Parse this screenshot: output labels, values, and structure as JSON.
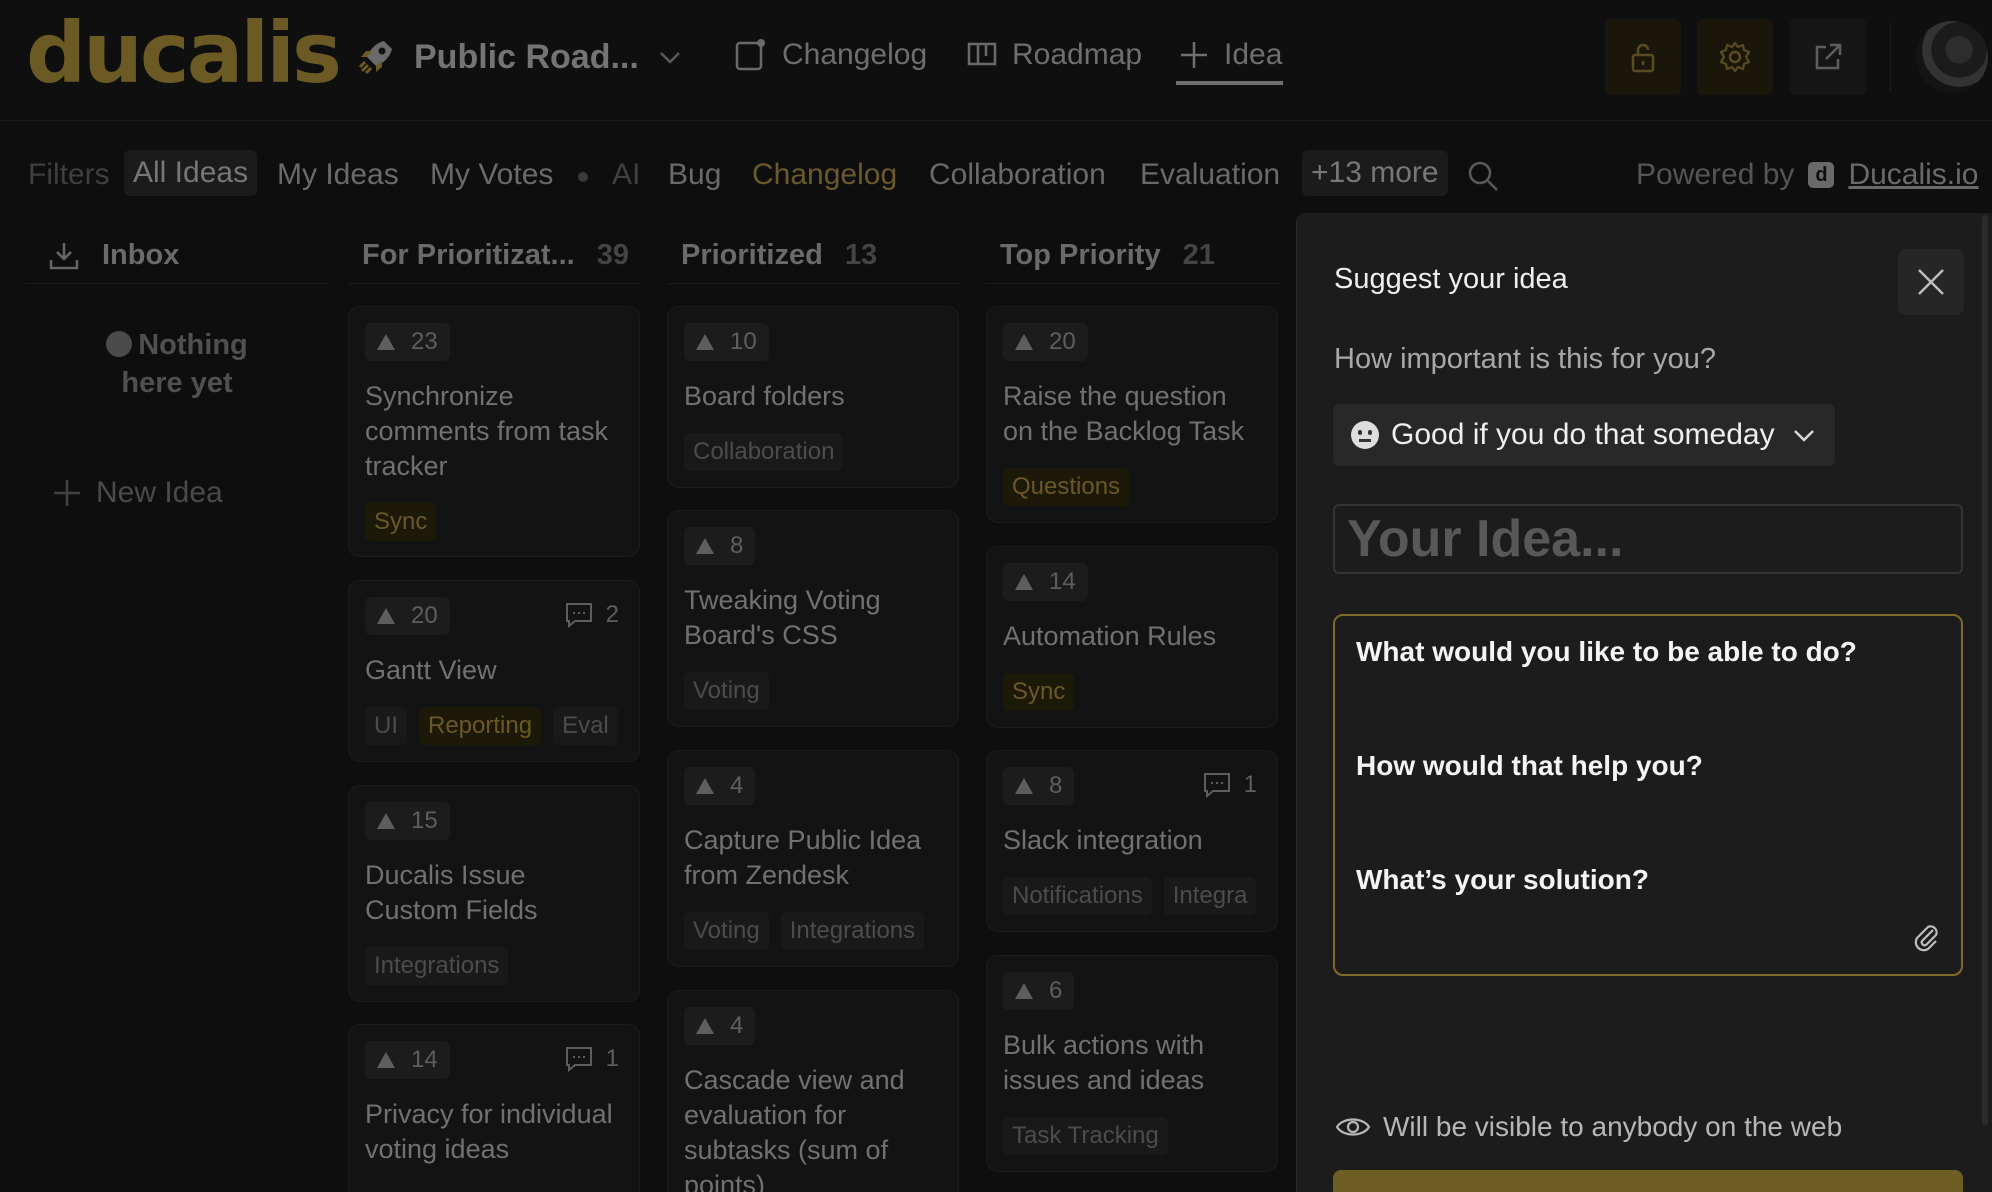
{
  "header": {
    "logo": "ducalis",
    "board_title": "Public Road...",
    "nav": [
      {
        "label": "Changelog"
      },
      {
        "label": "Roadmap"
      },
      {
        "label": "Idea"
      }
    ],
    "colors": {
      "accent": "#6b5a23",
      "bg": "#0e0e0e"
    }
  },
  "filters": {
    "label": "Filters",
    "items": [
      "All Ideas",
      "My Ideas",
      "My Votes"
    ],
    "tags": [
      "AI",
      "Bug",
      "Changelog",
      "Collaboration",
      "Evaluation"
    ],
    "more": "+13 more",
    "powered_by": "Powered by",
    "powered_logo": "d",
    "powered_link": "Ducalis.io"
  },
  "columns": [
    {
      "title": "Inbox",
      "empty_text_1": "Nothing",
      "empty_text_2": "here yet",
      "new_idea": "New Idea"
    },
    {
      "title": "For Prioritizat...",
      "count": "39",
      "cards": [
        {
          "votes": "23",
          "title": "Synchronize comments from task tracker",
          "tags": [
            "Sync"
          ]
        },
        {
          "votes": "20",
          "comments": "2",
          "title": "Gantt View",
          "tags": [
            "UI",
            "Reporting",
            "Eval"
          ]
        },
        {
          "votes": "15",
          "title": "Ducalis Issue Custom Fields",
          "tags": [
            "Integrations"
          ]
        },
        {
          "votes": "14",
          "comments": "1",
          "title": "Privacy for individual voting ideas",
          "tags": []
        }
      ]
    },
    {
      "title": "Prioritized",
      "count": "13",
      "cards": [
        {
          "votes": "10",
          "title": "Board folders",
          "tags": [
            "Collaboration"
          ]
        },
        {
          "votes": "8",
          "title": "Tweaking Voting Board's CSS",
          "tags": [
            "Voting"
          ]
        },
        {
          "votes": "4",
          "title": "Capture Public Idea from Zendesk",
          "tags": [
            "Voting",
            "Integrations"
          ]
        },
        {
          "votes": "4",
          "title": "Cascade view and evaluation for subtasks (sum of points)",
          "tags": []
        }
      ]
    },
    {
      "title": "Top Priority",
      "count": "21",
      "cards": [
        {
          "votes": "20",
          "title": "Raise the question on the Backlog Task",
          "tags": [
            "Questions"
          ]
        },
        {
          "votes": "14",
          "title": "Automation Rules",
          "tags": [
            "Sync"
          ]
        },
        {
          "votes": "8",
          "comments": "1",
          "title": "Slack integration",
          "tags": [
            "Notifications",
            "Integra"
          ]
        },
        {
          "votes": "6",
          "title": "Bulk actions with issues and ideas",
          "tags": [
            "Task Tracking"
          ]
        }
      ]
    }
  ],
  "panel": {
    "title": "Suggest your idea",
    "importance_question": "How important is this for you?",
    "importance_value": "Good if you do that someday",
    "idea_placeholder": "Your Idea...",
    "prompts": [
      "What would you like to be able to do?",
      "How would that help you?",
      "What’s your solution?"
    ],
    "visibility": "Will be visible to anybody on the web"
  }
}
